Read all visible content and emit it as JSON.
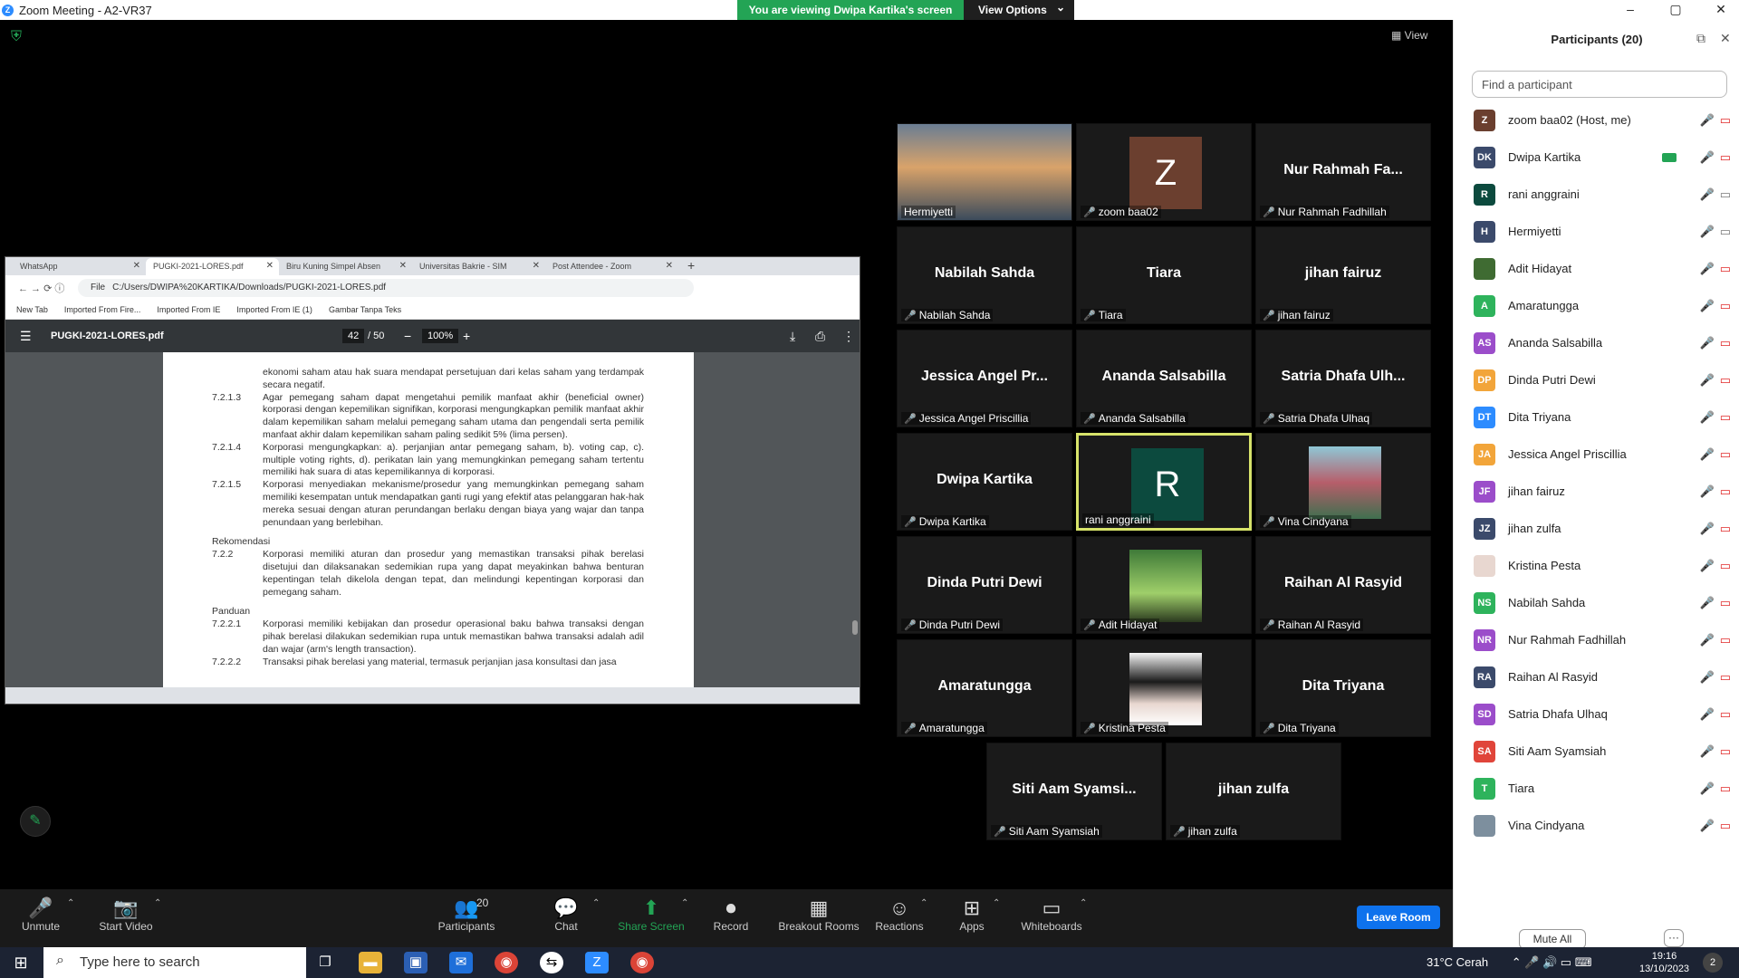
{
  "window": {
    "title": "Zoom Meeting - A2-VR37",
    "zoom_letter": "Z",
    "min": "–",
    "max": "▢",
    "close": "✕"
  },
  "share_banner": {
    "viewing": "You are viewing Dwipa Kartika's screen",
    "view_options": "View Options",
    "caret": "⌄"
  },
  "stage": {
    "view_label": "▦ View",
    "shield": "⛨"
  },
  "browser": {
    "tabs": [
      {
        "label": "WhatsApp",
        "x": "✕"
      },
      {
        "label": "PUGKI-2021-LORES.pdf",
        "x": "✕"
      },
      {
        "label": "Biru Kuning Simpel Absen",
        "x": "✕"
      },
      {
        "label": "Universitas Bakrie - SIM",
        "x": "✕"
      },
      {
        "label": "Post Attendee - Zoom",
        "x": "✕"
      }
    ],
    "new_tab": "+",
    "nav": "←  →  ⟳  ⓘ",
    "file_label": "File",
    "url": "C:/Users/DWIPA%20KARTIKA/Downloads/PUGKI-2021-LORES.pdf",
    "bookmarks": [
      "New Tab",
      "Imported From Fire...",
      "Imported From IE",
      "Imported From IE (1)",
      "Gambar Tanpa Teks"
    ],
    "pdf": {
      "menu": "☰",
      "filename": "PUGKI-2021-LORES.pdf",
      "page_current": "42",
      "page_total": "/ 50",
      "zoom": "100%",
      "zoom_out": "−",
      "zoom_in": "+",
      "download": "⤓",
      "print": "⎙",
      "more": "⋮"
    },
    "doc": {
      "l1": "ekonomi saham atau hak suara  mendapat persetujuan dari kelas saham yang terdampak secara negatif.",
      "n2": "7.2.1.3",
      "l2": "Agar pemegang saham dapat mengetahui pemilik manfaat akhir (beneficial owner) korporasi dengan kepemilikan signifikan, korporasi mengungkapkan pemilik manfaat akhir dalam kepemilikan saham melalui pemegang saham utama dan pengendali serta pemilik manfaat akhir dalam kepemilikan saham paling sedikit 5% (lima persen).",
      "n3": "7.2.1.4",
      "l3": "Korporasi mengungkapkan: a). perjanjian antar pemegang saham, b). voting cap, c). multiple voting rights, d). perikatan lain yang memungkinkan pemegang saham tertentu memiliki hak suara di atas kepemilikannya di korporasi.",
      "n4": "7.2.1.5",
      "l4": "Korporasi menyediakan mekanisme/prosedur yang memungkinkan pemegang saham memiliki kesempatan untuk mendapatkan ganti rugi yang efektif atas pelanggaran hak-hak mereka sesuai dengan aturan perundangan berlaku dengan biaya yang wajar dan tanpa penundaan yang berlebihan.",
      "h1": "Rekomendasi",
      "n5": "7.2.2",
      "l5": "Korporasi memiliki aturan dan prosedur yang memastikan transaksi pihak berelasi disetujui dan dilaksanakan sedemikian rupa yang dapat meyakinkan bahwa benturan kepentingan telah dikelola dengan tepat, dan melindungi kepentingan korporasi dan pemegang saham.",
      "h2": "Panduan",
      "n6": "7.2.2.1",
      "l6": "Korporasi memiliki kebijakan dan prosedur operasional baku bahwa transaksi dengan pihak berelasi dilakukan sedemikian rupa untuk memastikan bahwa transaksi adalah adil dan wajar (arm's length transaction).",
      "n7": "7.2.2.2",
      "l7": "Transaksi pihak berelasi yang material, termasuk perjanjian jasa konsultasi dan jasa"
    }
  },
  "tiles": [
    {
      "big": "",
      "label": "Hermiyetti"
    },
    {
      "big": "Z",
      "label": "zoom baa02",
      "color": "#6b3f2f"
    },
    {
      "big": "Nur Rahmah Fa...",
      "label": "Nur Rahmah Fadhillah"
    },
    {
      "big": "Nabilah Sahda",
      "label": "Nabilah Sahda"
    },
    {
      "big": "Tiara",
      "label": "Tiara"
    },
    {
      "big": "jihan fairuz",
      "label": "jihan fairuz"
    },
    {
      "big": "Jessica Angel Pr...",
      "label": "Jessica Angel Priscillia"
    },
    {
      "big": "Ananda Salsabilla",
      "label": "Ananda Salsabilla"
    },
    {
      "big": "Satria Dhafa Ulh...",
      "label": "Satria Dhafa Ulhaq"
    },
    {
      "big": "Dwipa Kartika",
      "label": "Dwipa Kartika"
    },
    {
      "big": "R",
      "label": "rani anggraini",
      "color": "#0c4a3e"
    },
    {
      "big": "",
      "label": "Vina Cindyana"
    },
    {
      "big": "Dinda Putri Dewi",
      "label": "Dinda Putri Dewi"
    },
    {
      "big": "",
      "label": "Adit Hidayat"
    },
    {
      "big": "Raihan Al Rasyid",
      "label": "Raihan Al Rasyid"
    },
    {
      "big": "Amaratungga",
      "label": "Amaratungga"
    },
    {
      "big": "",
      "label": "Kristina Pesta"
    },
    {
      "big": "Dita Triyana",
      "label": "Dita Triyana"
    },
    {
      "big": "Siti Aam Syamsi...",
      "label": "Siti Aam Syamsiah"
    },
    {
      "big": "jihan zulfa",
      "label": "jihan zulfa"
    }
  ],
  "participants": {
    "title": "Participants (20)",
    "search_placeholder": "Find a participant",
    "popout": "⧉",
    "close": "✕",
    "list": [
      {
        "initials": "Z",
        "name": "zoom baa02 (Host, me)",
        "color": "#6b3f2f"
      },
      {
        "initials": "DK",
        "name": "Dwipa Kartika",
        "color": "#3b4a6b"
      },
      {
        "initials": "R",
        "name": "rani anggraini",
        "color": "#0c4a3e"
      },
      {
        "initials": "H",
        "name": "Hermiyetti",
        "color": "#3b4a6b"
      },
      {
        "initials": "",
        "name": "Adit Hidayat",
        "color": "#3f6b32"
      },
      {
        "initials": "A",
        "name": "Amaratungga",
        "color": "#2eb35c"
      },
      {
        "initials": "AS",
        "name": "Ananda Salsabilla",
        "color": "#9b4dca"
      },
      {
        "initials": "DP",
        "name": "Dinda Putri Dewi",
        "color": "#f2a53a"
      },
      {
        "initials": "DT",
        "name": "Dita Triyana",
        "color": "#2d8cff"
      },
      {
        "initials": "JA",
        "name": "Jessica Angel Priscillia",
        "color": "#f2a53a"
      },
      {
        "initials": "JF",
        "name": "jihan fairuz",
        "color": "#9b4dca"
      },
      {
        "initials": "JZ",
        "name": "jihan zulfa",
        "color": "#3b4a6b"
      },
      {
        "initials": "",
        "name": "Kristina Pesta",
        "color": "#e8d7d0"
      },
      {
        "initials": "NS",
        "name": "Nabilah Sahda",
        "color": "#2eb35c"
      },
      {
        "initials": "NR",
        "name": "Nur Rahmah Fadhillah",
        "color": "#9b4dca"
      },
      {
        "initials": "RA",
        "name": "Raihan Al Rasyid",
        "color": "#3b4a6b"
      },
      {
        "initials": "SD",
        "name": "Satria Dhafa Ulhaq",
        "color": "#9b4dca"
      },
      {
        "initials": "SA",
        "name": "Siti Aam Syamsiah",
        "color": "#e0453a"
      },
      {
        "initials": "T",
        "name": "Tiara",
        "color": "#2eb35c"
      },
      {
        "initials": "",
        "name": "Vina Cindyana",
        "color": "#7d8f9e"
      }
    ],
    "mute_all": "Mute All",
    "more": "···"
  },
  "toolbar": {
    "unmute": "Unmute",
    "start_video": "Start Video",
    "participants": "Participants",
    "participants_count": "20",
    "chat": "Chat",
    "share_screen": "Share Screen",
    "record": "Record",
    "breakout": "Breakout Rooms",
    "reactions": "Reactions",
    "apps": "Apps",
    "whiteboards": "Whiteboards",
    "leave": "Leave Room",
    "caret": "⌃"
  },
  "taskbar": {
    "search_placeholder": "Type here to search",
    "weather": "31°C  Cerah",
    "time": "19:16",
    "date": "13/10/2023",
    "notif_count": "2"
  },
  "icons": {
    "win": "⊞",
    "search": "⌕",
    "mute": "🎙̸",
    "video": "▭"
  }
}
